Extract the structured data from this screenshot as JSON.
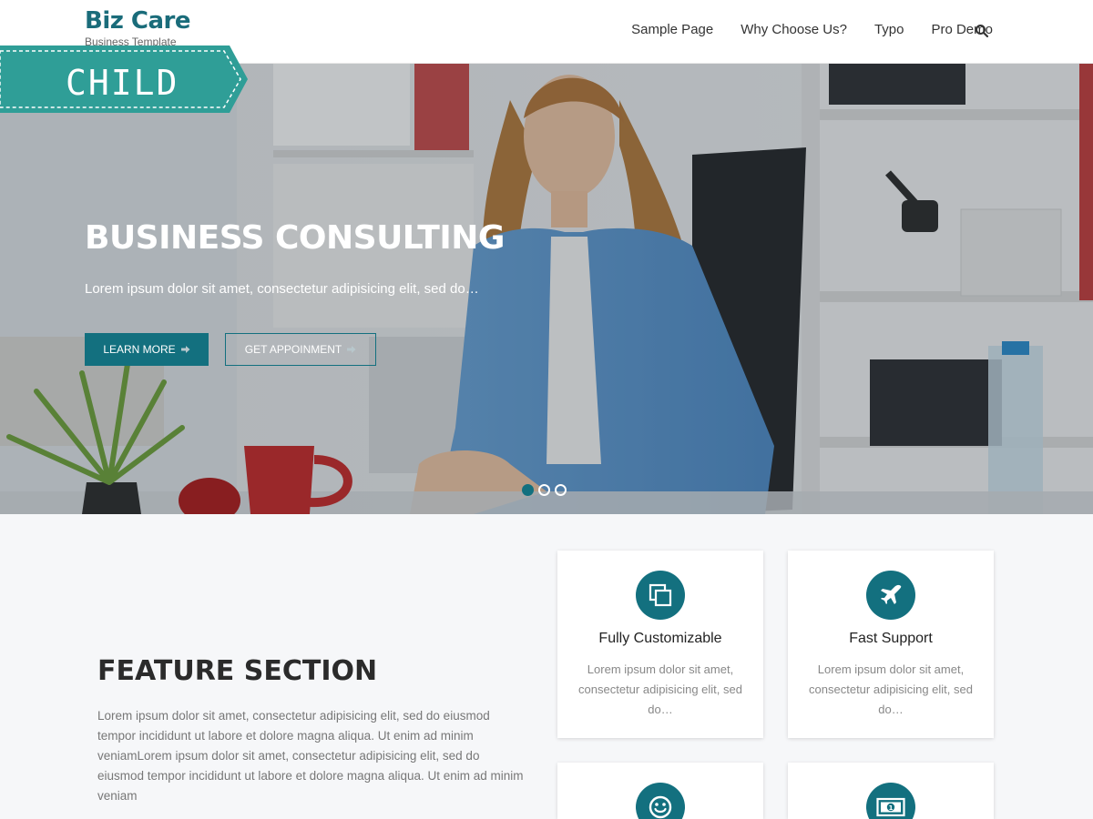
{
  "header": {
    "logo_title": "Biz Care",
    "logo_tagline": "Business Template",
    "nav": [
      "Sample Page",
      "Why Choose Us?",
      "Typo",
      "Pro Demo"
    ],
    "search_icon": "search-icon"
  },
  "ribbon": {
    "label": "CHILD",
    "color": "#2f9e97"
  },
  "hero": {
    "title": "BUSINESS CONSULTING",
    "subtitle": "Lorem ipsum dolor sit amet, consectetur adipisicing elit, sed do…",
    "learn_more": "LEARN MORE",
    "get_appointment": "GET APPOINMENT",
    "slides_count": 3,
    "active_slide": 1
  },
  "feature": {
    "title": "FEATURE SECTION",
    "text": "Lorem ipsum dolor sit amet, consectetur adipisicing elit, sed do eiusmod tempor incididunt ut labore et dolore magna aliqua. Ut enim ad minim veniamLorem ipsum dolor sit amet, consectetur adipisicing elit, sed do eiusmod tempor incididunt ut labore et dolore magna aliqua. Ut enim ad minim veniam",
    "cards": [
      {
        "title": "Fully Customizable",
        "text": "Lorem ipsum dolor sit amet, consectetur adipisicing elit, sed do…",
        "icon": "copy-icon"
      },
      {
        "title": "Fast Support",
        "text": "Lorem ipsum dolor sit amet, consectetur adipisicing elit, sed do…",
        "icon": "airplane-icon"
      },
      {
        "title": "",
        "text": "",
        "icon": "smile-icon"
      },
      {
        "title": "",
        "text": "",
        "icon": "money-icon"
      }
    ]
  },
  "colors": {
    "accent": "#13707f",
    "logo": "#1a6c7a"
  }
}
